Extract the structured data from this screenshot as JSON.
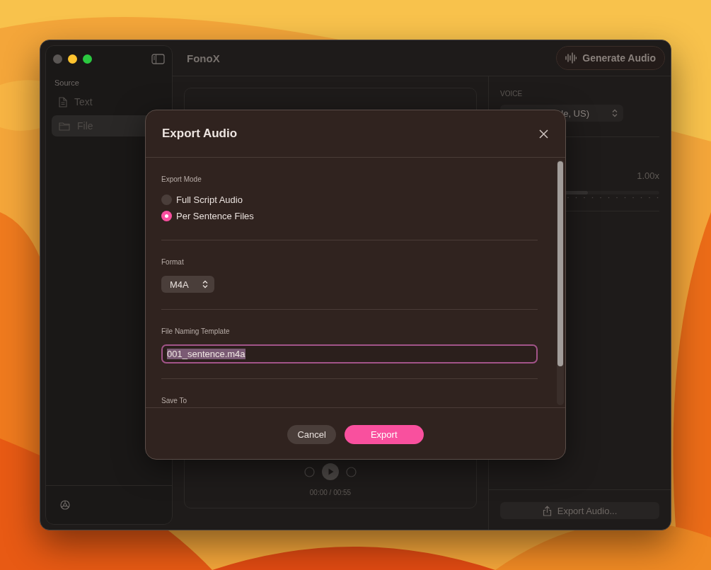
{
  "sidebar": {
    "section": "Source",
    "items": [
      {
        "label": "Text",
        "kind": "document",
        "selected": false
      },
      {
        "label": "File",
        "kind": "folder",
        "selected": true
      }
    ]
  },
  "header": {
    "title": "FonoX",
    "generate_button": "Generate Audio"
  },
  "player": {
    "time": "00:00 / 00:55"
  },
  "voice": {
    "label": "VOICE",
    "value": "le, US)"
  },
  "speed": {
    "reading": "1.00x",
    "level": 0.55
  },
  "export_audio_button": "Export Audio...",
  "dialog": {
    "title": "Export Audio",
    "export_mode": {
      "label": "Export Mode",
      "options": [
        {
          "label": "Full Script Audio",
          "selected": false
        },
        {
          "label": "Per Sentence Files",
          "selected": true
        }
      ]
    },
    "format": {
      "label": "Format",
      "value": "M4A"
    },
    "naming": {
      "label": "File Naming Template",
      "value": "001_sentence.m4a",
      "text_selected": true
    },
    "save_to": {
      "label": "Save To"
    },
    "buttons": [
      {
        "label": "Cancel",
        "kind": "secondary"
      },
      {
        "label": "Export",
        "kind": "primary"
      }
    ]
  }
}
